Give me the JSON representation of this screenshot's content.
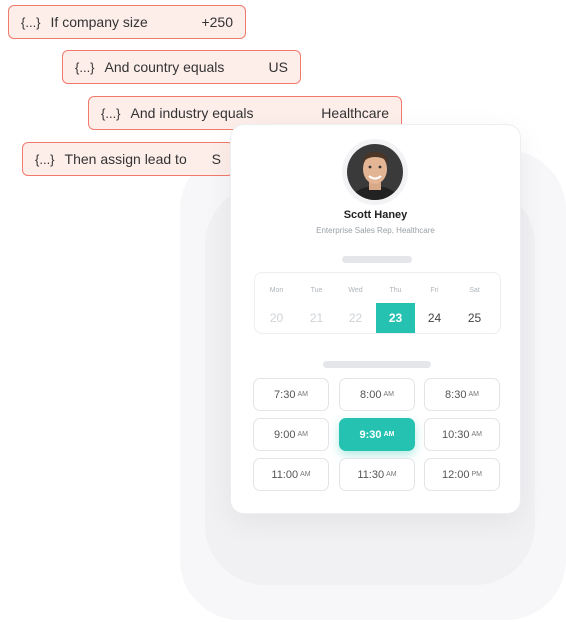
{
  "rules": [
    {
      "brace": "{...}",
      "text": "If company size",
      "value": "+250"
    },
    {
      "brace": "{...}",
      "text": "And country equals",
      "value": "US"
    },
    {
      "brace": "{...}",
      "text": "And industry equals",
      "value": "Healthcare"
    },
    {
      "brace": "{...}",
      "text": "Then assign lead to",
      "value": "S"
    }
  ],
  "profile": {
    "name": "Scott Haney",
    "title": "Enterprise Sales Rep, Healthcare",
    "avatar_icon": "person-avatar"
  },
  "calendar": {
    "days": [
      {
        "name": "Mon",
        "num": "20"
      },
      {
        "name": "Tue",
        "num": "21"
      },
      {
        "name": "Wed",
        "num": "22"
      },
      {
        "name": "Thu",
        "num": "23"
      },
      {
        "name": "Fri",
        "num": "24"
      },
      {
        "name": "Sat",
        "num": "25"
      }
    ],
    "selected_day": "23"
  },
  "slots": [
    {
      "time": "7:30",
      "ampm": "AM"
    },
    {
      "time": "8:00",
      "ampm": "AM"
    },
    {
      "time": "8:30",
      "ampm": "AM"
    },
    {
      "time": "9:00",
      "ampm": "AM"
    },
    {
      "time": "9:30",
      "ampm": "AM"
    },
    {
      "time": "10:30",
      "ampm": "AM"
    },
    {
      "time": "11:00",
      "ampm": "AM"
    },
    {
      "time": "11:30",
      "ampm": "AM"
    },
    {
      "time": "12:00",
      "ampm": "PM"
    }
  ],
  "selected_slot": "9:30",
  "colors": {
    "accent": "#26c2b1",
    "rule_border": "#f07a6e",
    "rule_bg": "#fdeeea"
  }
}
